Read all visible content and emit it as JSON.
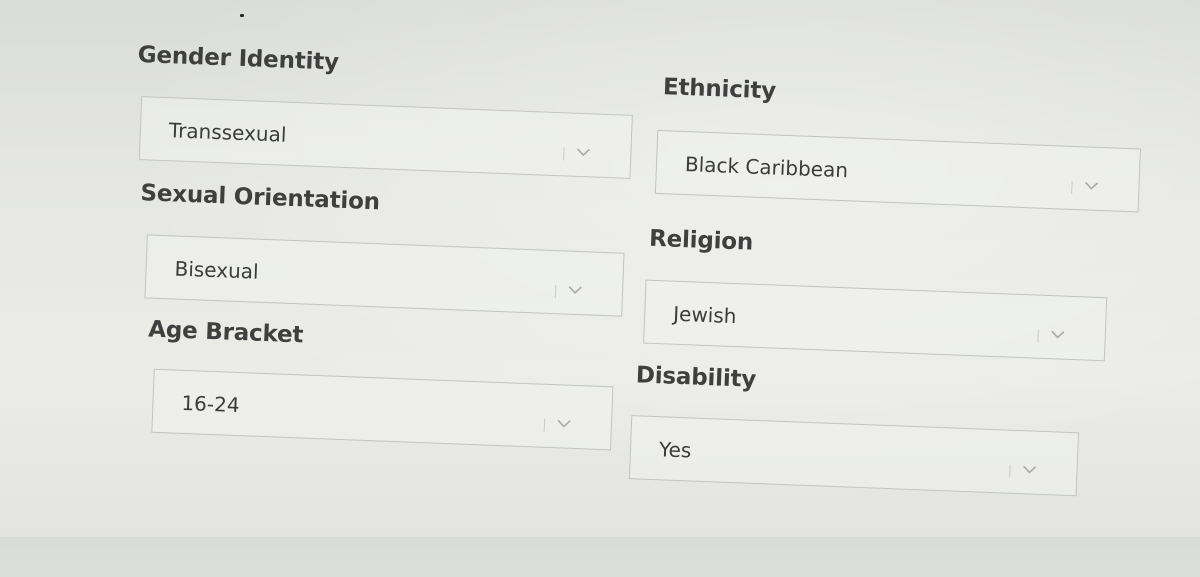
{
  "form": {
    "fields": [
      {
        "id": "gender-identity",
        "label": "Gender Identity",
        "value": "Transsexual"
      },
      {
        "id": "sexual-orientation",
        "label": "Sexual Orientation",
        "value": "Bisexual"
      },
      {
        "id": "age-bracket",
        "label": "Age Bracket",
        "value": "16-24"
      },
      {
        "id": "ethnicity",
        "label": "Ethnicity",
        "value": "Black Caribbean"
      },
      {
        "id": "religion",
        "label": "Religion",
        "value": "Jewish"
      },
      {
        "id": "disability",
        "label": "Disability",
        "value": "Yes"
      }
    ]
  },
  "icons": {
    "dropdown": "chevron-down-icon"
  },
  "colors": {
    "label_text": "#3e3f3e",
    "value_text": "#3a3b3a",
    "field_border": "#c2c4c1",
    "background": "#e6e7e4"
  }
}
